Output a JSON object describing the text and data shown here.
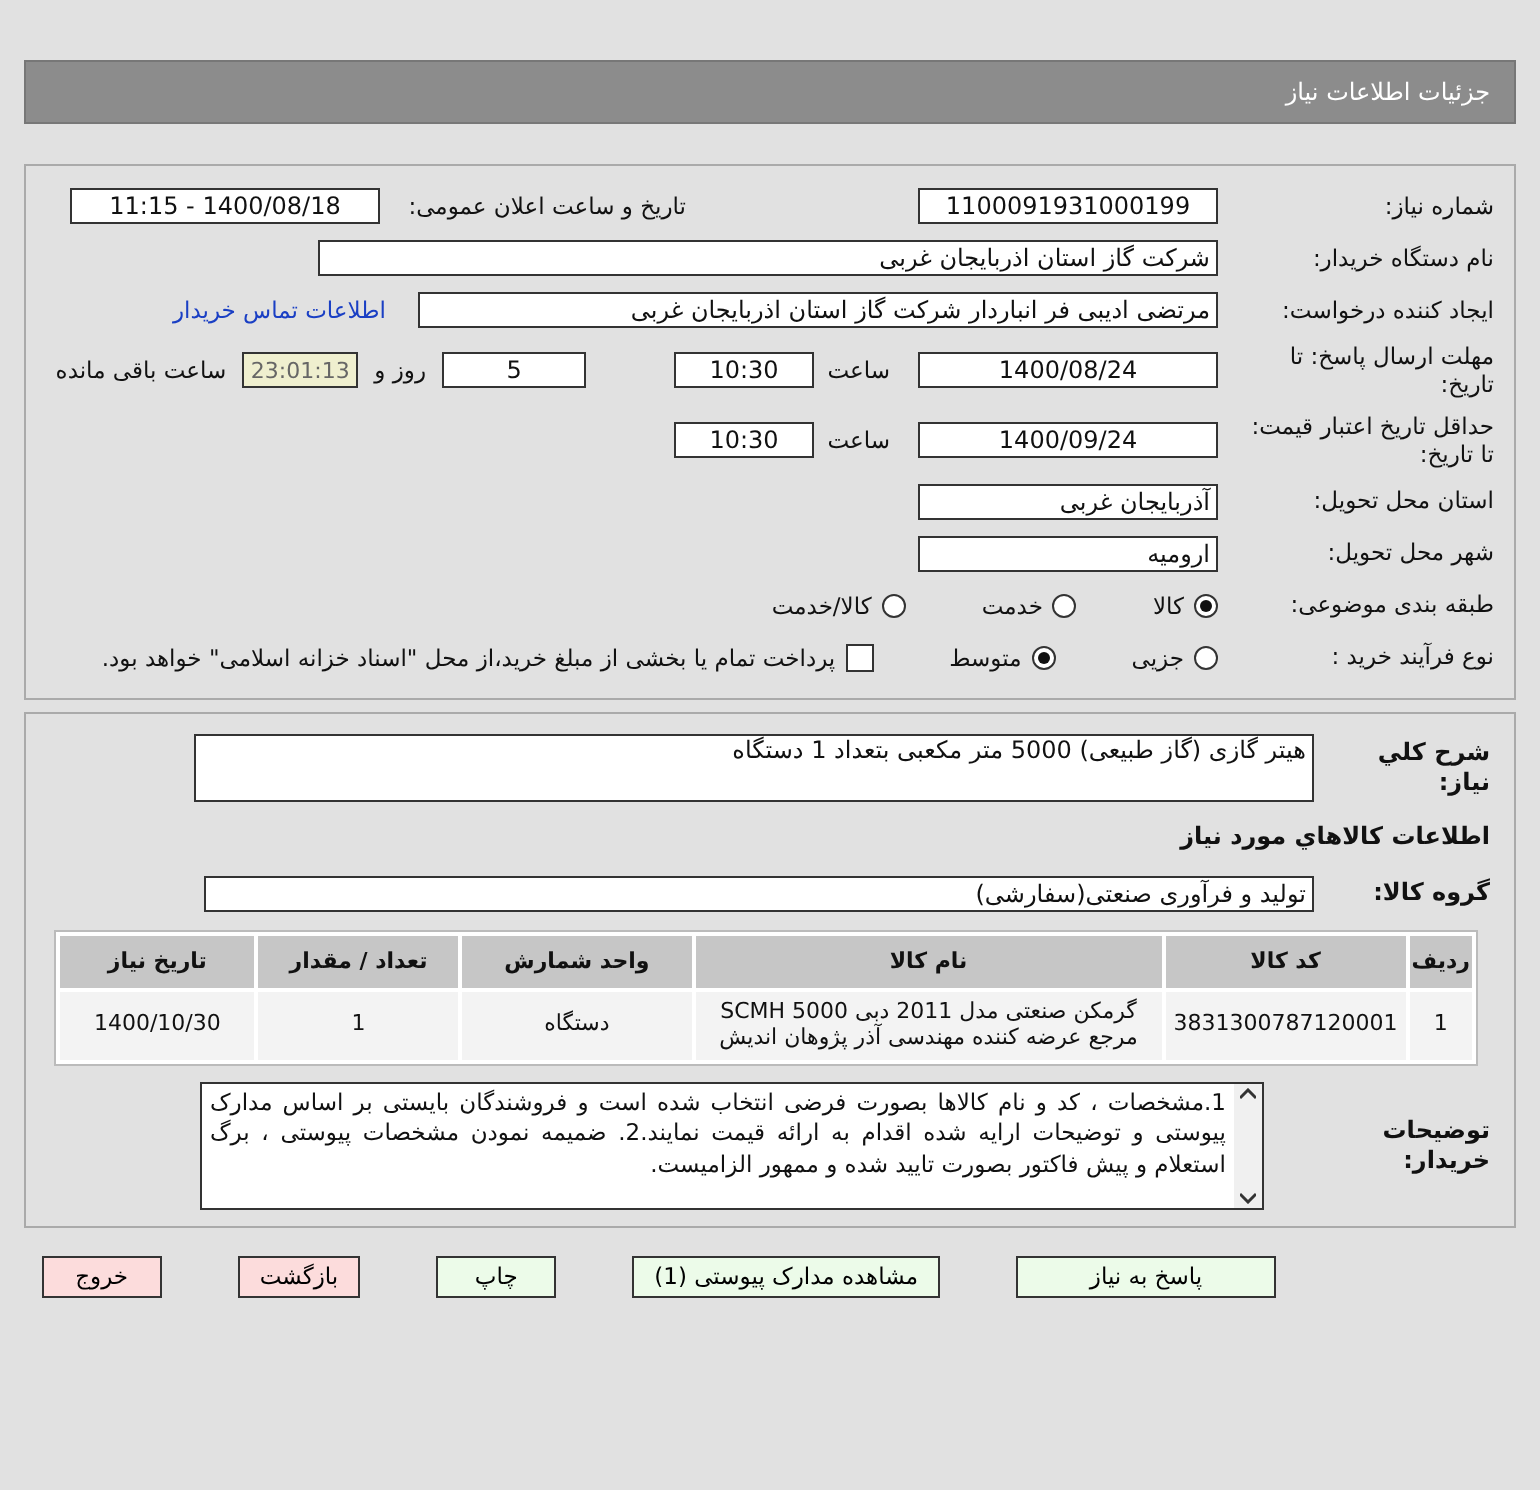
{
  "title": "جزئیات اطلاعات نیاز",
  "details": {
    "need_number": {
      "label": "شماره نیاز:",
      "value": "1100091931000199"
    },
    "announce": {
      "label": "تاریخ و ساعت اعلان عمومی:",
      "value": "1400/08/18 - 11:15"
    },
    "buyer": {
      "label": "نام دستگاه خریدار:",
      "value": "شرکت گاز استان اذربایجان غربی"
    },
    "requester": {
      "label": "ایجاد کننده درخواست:",
      "value": "مرتضی ادیبی فر انباردار شرکت گاز استان اذربایجان غربی",
      "link": "اطلاعات تماس خریدار"
    },
    "deadline": {
      "label": "مهلت ارسال پاسخ: تا تاریخ:",
      "date": "1400/08/24",
      "time_label": "ساعت",
      "time": "10:30",
      "days": "5",
      "days_label": "روز و",
      "remaining": "23:01:13",
      "remaining_label": "ساعت باقی مانده"
    },
    "validity": {
      "label": "حداقل تاریخ اعتبار قیمت: تا تاریخ:",
      "date": "1400/09/24",
      "time_label": "ساعت",
      "time": "10:30"
    },
    "province": {
      "label": "استان محل تحویل:",
      "value": "آذربایجان غربی"
    },
    "city": {
      "label": "شهر محل تحویل:",
      "value": "ارومیه"
    },
    "category": {
      "label": "طبقه بندی موضوعی:",
      "options": [
        {
          "label": "کالا",
          "selected": true
        },
        {
          "label": "خدمت",
          "selected": false
        },
        {
          "label": "کالا/خدمت",
          "selected": false
        }
      ]
    },
    "process": {
      "label": "نوع فرآیند خرید :",
      "options": [
        {
          "label": "جزیی",
          "selected": false
        },
        {
          "label": "متوسط",
          "selected": true
        }
      ],
      "payment": {
        "checked": false,
        "text": "پرداخت تمام یا بخشی از مبلغ خرید،از محل \"اسناد خزانه اسلامی\" خواهد بود."
      }
    }
  },
  "needs": {
    "summary_label": "شرح کلي نياز:",
    "summary": "هیتر گازی (گاز طبیعی) 5000 متر مکعبی بتعداد 1 دستگاه",
    "goods_heading": "اطلاعات كالاهاي مورد نياز",
    "group_label": "گروه کالا:",
    "group": "تولید و فرآوری صنعتی(سفارشی)",
    "table": {
      "columns": [
        "ردیف",
        "کد کالا",
        "نام کالا",
        "واحد شمارش",
        "تعداد / مقدار",
        "تاریخ نیاز"
      ],
      "rows": [
        [
          "1",
          "3831300787120001",
          "گرمکن صنعتی مدل 2011 دبی SCMH 5000 مرجع عرضه کننده مهندسی آذر پژوهان اندیش",
          "دستگاه",
          "1",
          "1400/10/30"
        ]
      ]
    },
    "notes_label": "توضیحات خریدار:",
    "notes": "1.مشخصات ، کد و نام کالاها بصورت فرضی انتخاب شده است و فروشندگان بایستی بر اساس مدارک پیوستی و توضیحات ارایه شده اقدام به ارائه قیمت نمایند.2. ضمیمه نمودن مشخصات پیوستی ، برگ استعلام و پیش فاکتور بصورت تایید شده و ممهور الزامیست."
  },
  "buttons": [
    {
      "label": "پاسخ به نیاز",
      "kind": "action"
    },
    {
      "label": "مشاهده مدارک پیوستی (1)",
      "kind": "action"
    },
    {
      "label": "چاپ",
      "kind": "action"
    },
    {
      "label": "بازگشت",
      "kind": "exit"
    },
    {
      "label": "خروج",
      "kind": "exit"
    }
  ]
}
